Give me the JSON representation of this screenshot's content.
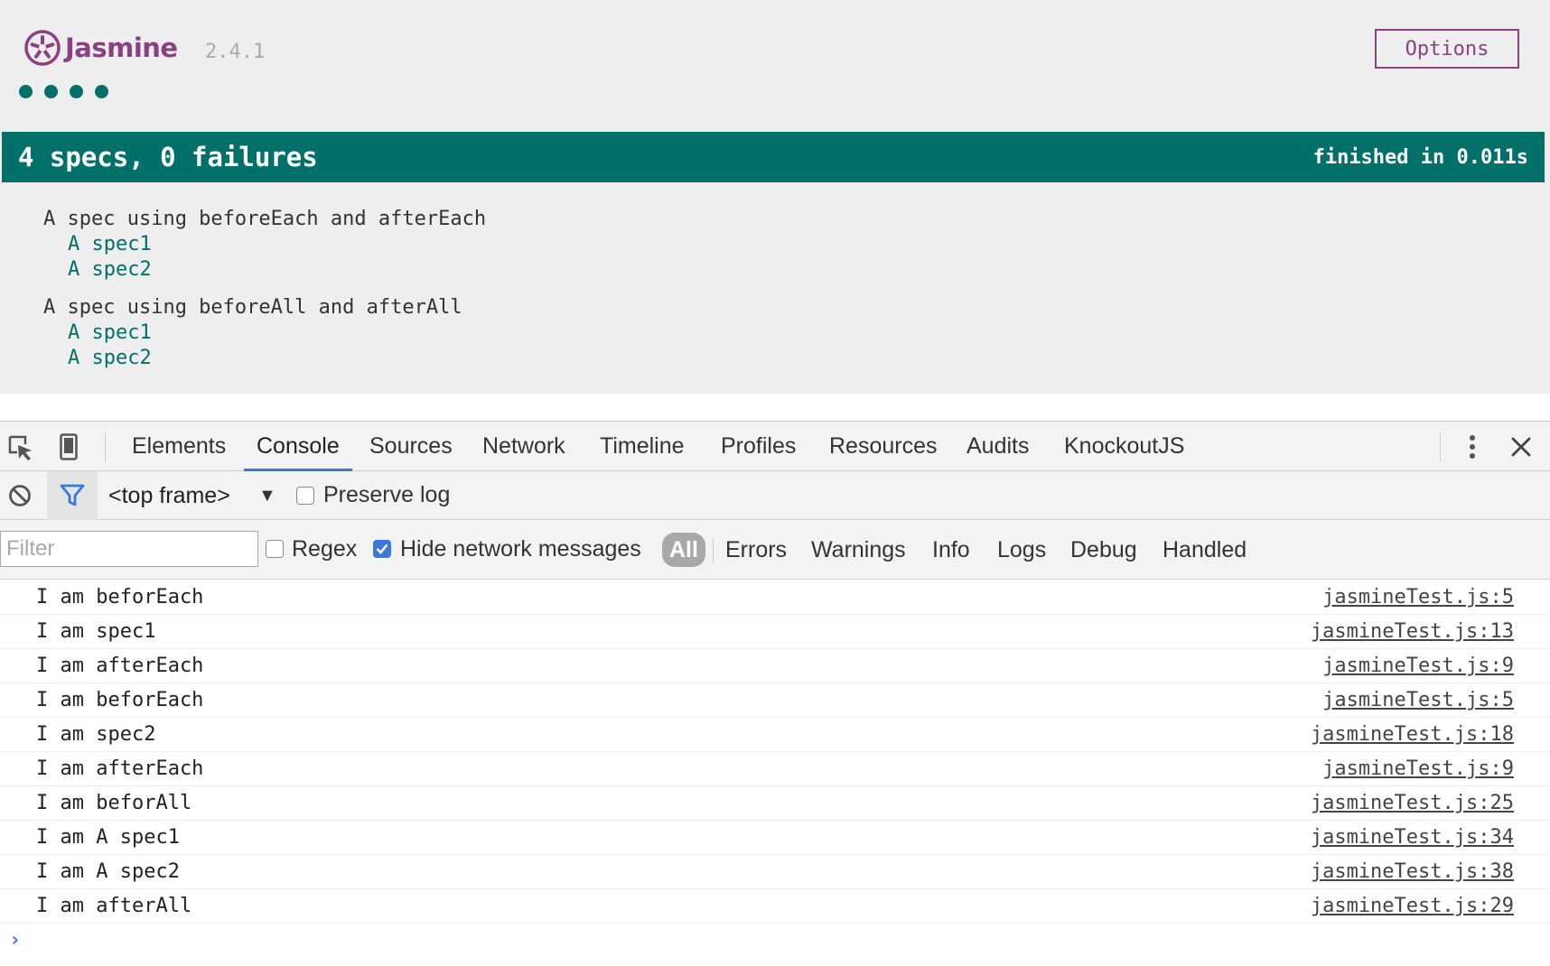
{
  "jasmine": {
    "logo_text": "Jasmine",
    "version": "2.4.1",
    "options_label": "Options",
    "dots_count": 4,
    "summary": "4 specs, 0 failures",
    "duration": "finished in 0.011s",
    "accent_color": "#007069",
    "brand_color": "#8a4182",
    "suites": [
      {
        "title": "A spec using beforeEach and afterEach",
        "specs": [
          "A spec1",
          "A spec2"
        ]
      },
      {
        "title": "A spec using beforeAll and afterAll",
        "specs": [
          "A spec1",
          "A spec2"
        ]
      }
    ]
  },
  "devtools": {
    "toolbar_icons": [
      "inspect-element-icon",
      "device-mode-icon",
      "more-vert-icon",
      "close-icon"
    ],
    "tabs": [
      "Elements",
      "Console",
      "Sources",
      "Network",
      "Timeline",
      "Profiles",
      "Resources",
      "Audits",
      "KnockoutJS"
    ],
    "active_tab": "Console",
    "frame_selector": "<top frame>",
    "preserve_log_label": "Preserve log",
    "filter_placeholder": "Filter",
    "regex_label": "Regex",
    "hide_network_label": "Hide network messages",
    "levels": [
      "All",
      "Errors",
      "Warnings",
      "Info",
      "Logs",
      "Debug",
      "Handled"
    ],
    "console_rows": [
      {
        "message": "I am beforEach",
        "source": "jasmineTest.js:5"
      },
      {
        "message": "I am spec1",
        "source": "jasmineTest.js:13"
      },
      {
        "message": "I am afterEach",
        "source": "jasmineTest.js:9"
      },
      {
        "message": "I am beforEach",
        "source": "jasmineTest.js:5"
      },
      {
        "message": "I am spec2",
        "source": "jasmineTest.js:18"
      },
      {
        "message": "I am afterEach",
        "source": "jasmineTest.js:9"
      },
      {
        "message": "I am beforAll",
        "source": "jasmineTest.js:25"
      },
      {
        "message": "I am A spec1",
        "source": "jasmineTest.js:34"
      },
      {
        "message": "I am A spec2",
        "source": "jasmineTest.js:38"
      },
      {
        "message": "I am afterAll",
        "source": "jasmineTest.js:29"
      }
    ],
    "prompt_symbol": "›"
  }
}
